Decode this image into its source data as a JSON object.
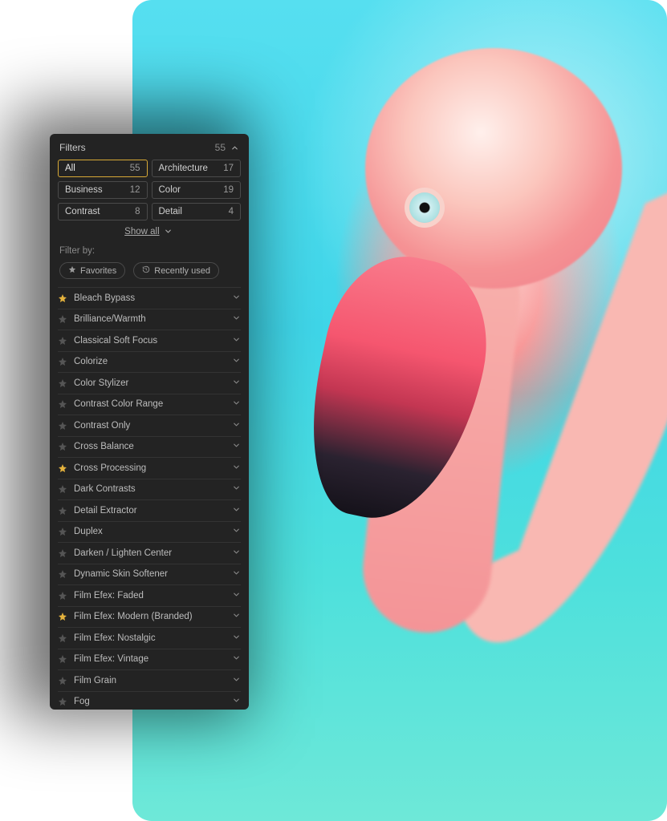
{
  "panel": {
    "title": "Filters",
    "total_count": "55",
    "show_all_label": "Show all",
    "filter_by_label": "Filter by:",
    "favorites_label": "Favorites",
    "recently_used_label": "Recently used"
  },
  "categories": [
    {
      "label": "All",
      "count": "55",
      "active": true
    },
    {
      "label": "Architecture",
      "count": "17",
      "active": false
    },
    {
      "label": "Business",
      "count": "12",
      "active": false
    },
    {
      "label": "Color",
      "count": "19",
      "active": false
    },
    {
      "label": "Contrast",
      "count": "8",
      "active": false
    },
    {
      "label": "Detail",
      "count": "4",
      "active": false
    }
  ],
  "filters": [
    {
      "label": "Bleach Bypass",
      "favorite": true
    },
    {
      "label": "Brilliance/Warmth",
      "favorite": false
    },
    {
      "label": "Classical Soft Focus",
      "favorite": false
    },
    {
      "label": "Colorize",
      "favorite": false
    },
    {
      "label": "Color Stylizer",
      "favorite": false
    },
    {
      "label": "Contrast Color Range",
      "favorite": false
    },
    {
      "label": "Contrast Only",
      "favorite": false
    },
    {
      "label": "Cross Balance",
      "favorite": false
    },
    {
      "label": "Cross Processing",
      "favorite": true
    },
    {
      "label": "Dark Contrasts",
      "favorite": false
    },
    {
      "label": "Detail Extractor",
      "favorite": false
    },
    {
      "label": "Duplex",
      "favorite": false
    },
    {
      "label": "Darken / Lighten Center",
      "favorite": false
    },
    {
      "label": "Dynamic Skin Softener",
      "favorite": false
    },
    {
      "label": "Film Efex: Faded",
      "favorite": false
    },
    {
      "label": "Film Efex: Modern (Branded)",
      "favorite": true
    },
    {
      "label": "Film Efex: Nostalgic",
      "favorite": false
    },
    {
      "label": "Film Efex: Vintage",
      "favorite": false
    },
    {
      "label": "Film Grain",
      "favorite": false
    },
    {
      "label": "Fog",
      "favorite": false
    }
  ]
}
